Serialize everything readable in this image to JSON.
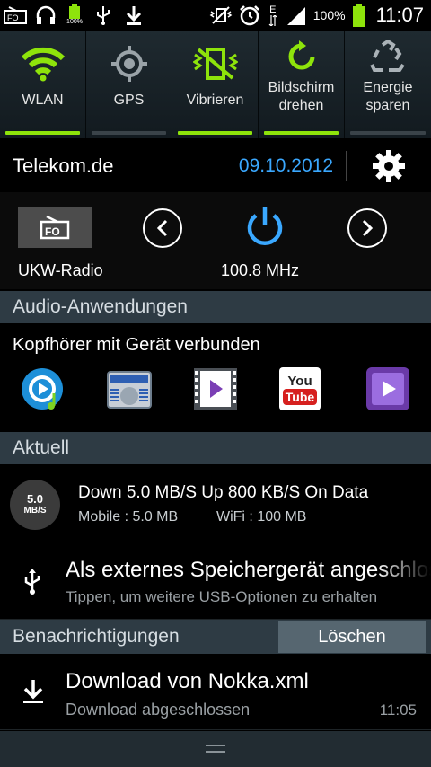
{
  "statusbar": {
    "icons": [
      "radio-icon",
      "headphones-icon",
      "battery-small-icon",
      "usb-icon",
      "download-icon",
      "mute-vibrate-icon",
      "alarm-icon",
      "edge-network-icon",
      "signal-icon"
    ],
    "network_label": "E",
    "battery_small_label": "100%",
    "battery_percent": "100%",
    "time": "11:07",
    "colors": {
      "battery": "#8ee30b"
    }
  },
  "toggles": [
    {
      "id": "wlan",
      "label": "WLAN",
      "icon": "wifi-icon",
      "on": true
    },
    {
      "id": "gps",
      "label": "GPS",
      "icon": "gps-icon",
      "on": false
    },
    {
      "id": "vibration",
      "label": "Vibrieren",
      "icon": "vibrate-icon",
      "on": true
    },
    {
      "id": "rotate",
      "label": "Bildschirm\ndrehen",
      "icon": "rotate-icon",
      "on": true
    },
    {
      "id": "power",
      "label": "Energie\nsparen",
      "icon": "recycle-icon",
      "on": false
    }
  ],
  "carrier": {
    "name": "Telekom.de",
    "date": "09.10.2012",
    "settings_icon": "gear-icon"
  },
  "radio": {
    "label": "UKW-Radio",
    "frequency": "100.8 MHz",
    "icons": [
      "radio-icon",
      "previous-icon",
      "power-icon",
      "next-icon"
    ]
  },
  "audio": {
    "header": "Audio-Anwendungen",
    "title": "Kopfhörer mit Gerät verbunden",
    "apps": [
      "music-player-icon",
      "radio-app-icon",
      "video-player-icon",
      "youtube-icon",
      "video-editor-icon"
    ],
    "youtube_text_top": "You",
    "youtube_text_bottom": "Tube"
  },
  "current": {
    "header": "Aktuell"
  },
  "data_notification": {
    "badge_value": "5.0",
    "badge_unit": "MB/S",
    "title": "Down 5.0 MB/S Up 800 KB/S On Data",
    "mobile": "Mobile : 5.0 MB",
    "wifi": "WiFi : 100 MB"
  },
  "usb_notification": {
    "icon": "usb-icon",
    "title": "Als externes Speichergerät angeschlossen",
    "subtitle": "Tippen, um weitere USB-Optionen zu erhalten"
  },
  "notifications": {
    "header": "Benachrichtigungen",
    "clear_label": "Löschen"
  },
  "download_notification": {
    "icon": "download-icon",
    "title": "Download von Nokka.xml",
    "subtitle": "Download abgeschlossen",
    "time": "11:05"
  },
  "handle": {
    "icon": "drag-handle-icon"
  },
  "colors": {
    "accent_green": "#8ee30b",
    "accent_blue": "#3aa8ff",
    "section_bg": "#2e3b44"
  }
}
